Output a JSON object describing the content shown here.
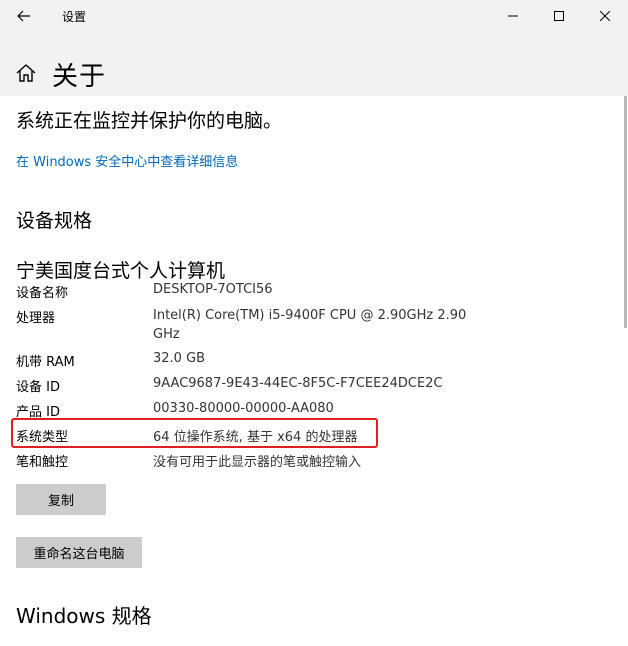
{
  "window": {
    "title": "设置",
    "back_icon": "arrow-left-icon",
    "min_icon": "minimize-icon",
    "max_icon": "maximize-icon",
    "close_icon": "close-icon"
  },
  "header": {
    "home_icon": "home-icon",
    "title": "关于"
  },
  "security": {
    "status_text": "系统正在监控并保护你的电脑。",
    "link_text": "在 Windows 安全中心中查看详细信息"
  },
  "device_specs": {
    "section_title": "设备规格",
    "device_name_title": "宁美国度台式个人计算机",
    "rows": [
      {
        "label": "设备名称",
        "value": "DESKTOP-7OTCI56"
      },
      {
        "label": "处理器",
        "value": "Intel(R) Core(TM) i5-9400F CPU @ 2.90GHz   2.90 GHz"
      },
      {
        "label": "机带 RAM",
        "value": "32.0 GB"
      },
      {
        "label": "设备 ID",
        "value": "9AAC9687-9E43-44EC-8F5C-F7CEE24DCE2C"
      },
      {
        "label": "产品 ID",
        "value": "00330-80000-00000-AA080"
      },
      {
        "label": "系统类型",
        "value": "64 位操作系统, 基于 x64 的处理器"
      },
      {
        "label": "笔和触控",
        "value": "没有可用于此显示器的笔或触控输入"
      }
    ],
    "copy_button": "复制",
    "rename_button": "重命名这台电脑"
  },
  "windows_specs": {
    "section_title": "Windows 规格"
  },
  "colors": {
    "link": "#0067b8",
    "highlight": "#e02020",
    "button_bg": "#cccccc",
    "header_bg": "#f2f2f2"
  }
}
